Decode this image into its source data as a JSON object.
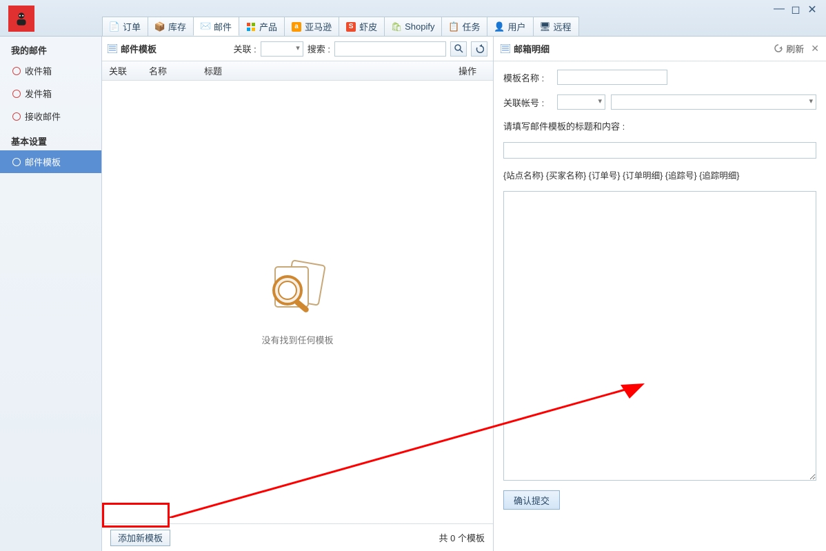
{
  "tabs": {
    "orders": "订单",
    "inventory": "库存",
    "mail": "邮件",
    "products": "产品",
    "amazon": "亚马逊",
    "shopee": "虾皮",
    "shopify": "Shopify",
    "tasks": "任务",
    "users": "用户",
    "remote": "远程"
  },
  "sidebar": {
    "group1": "我的邮件",
    "inbox": "收件箱",
    "outbox": "发件箱",
    "receive": "接收邮件",
    "group2": "基本设置",
    "templates": "邮件模板"
  },
  "center": {
    "title": "邮件模板",
    "related_label": "关联 :",
    "search_label": "搜索 :",
    "col_related": "关联",
    "col_name": "名称",
    "col_title": "标题",
    "col_action": "操作",
    "empty": "没有找到任何模板",
    "add_btn": "添加新模板",
    "count": "共 0 个模板"
  },
  "right": {
    "title": "邮箱明细",
    "refresh": "刷新",
    "name_label": "模板名称 :",
    "account_label": "关联帐号 :",
    "hint": "请填写邮件模板的标题和内容 :",
    "vars": "{站点名称} {买家名称} {订单号} {订单明细} {追踪号} {追踪明细}",
    "submit": "确认提交"
  }
}
